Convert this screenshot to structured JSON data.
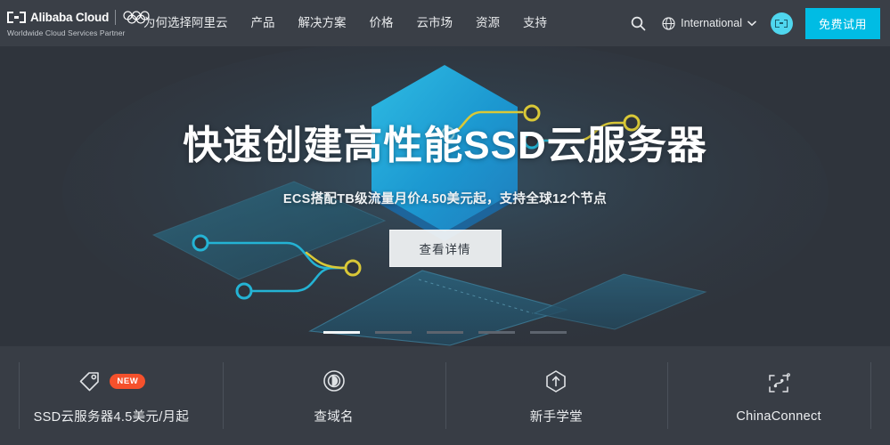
{
  "header": {
    "logo": {
      "mark_icon": "alibaba-cloud-mark-icon",
      "wordmark": "Alibaba Cloud",
      "rings_icon": "olympic-rings-icon",
      "tagline": "Worldwide Cloud Services Partner"
    },
    "nav": [
      {
        "label": "为何选择阿里云"
      },
      {
        "label": "产品"
      },
      {
        "label": "解决方案"
      },
      {
        "label": "价格"
      },
      {
        "label": "云市场"
      },
      {
        "label": "资源"
      },
      {
        "label": "支持"
      }
    ],
    "right": {
      "search_icon": "search-icon",
      "locale_icon": "globe-icon",
      "locale_label": "International",
      "locale_caret": "chevron-down-icon",
      "avatar_icon": "account-avatar-icon",
      "trial_label": "免费试用"
    }
  },
  "hero": {
    "title": "快速创建高性能SSD云服务器",
    "subtitle": "ECS搭配TB级流量月价4.50美元起，支持全球12个节点",
    "cta_label": "查看详情",
    "carousel": {
      "count": 5,
      "active_index": 0
    },
    "art": {
      "hexagon_color": "#1fa8dd",
      "node_yellow": "#e8cf3c",
      "node_cyan": "#25b6d6",
      "plane_color": "#2b5d73",
      "background": "#2f343c"
    }
  },
  "features": [
    {
      "icon": "price-tag-icon",
      "badge": "NEW",
      "label": "SSD云服务器4.5美元/月起"
    },
    {
      "icon": "domain-search-icon",
      "badge": null,
      "label": "查域名"
    },
    {
      "icon": "upload-hexagon-icon",
      "badge": null,
      "label": "新手学堂"
    },
    {
      "icon": "china-connect-icon",
      "badge": null,
      "label": "ChinaConnect"
    }
  ],
  "colors": {
    "page_background": "#383d45",
    "header_background": "#3a3f47",
    "hero_background": "#2f343c",
    "accent_cyan": "#00bce4",
    "badge_orange": "#f5512c"
  }
}
